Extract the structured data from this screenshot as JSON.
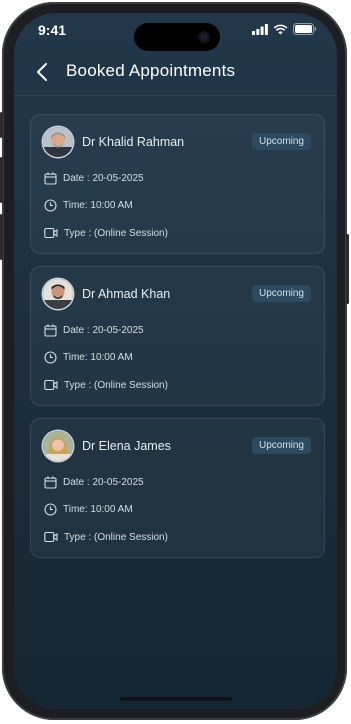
{
  "status_bar": {
    "time": "9:41",
    "icons": [
      "signal-icon",
      "wifi-icon",
      "battery-icon"
    ]
  },
  "header": {
    "back_icon": "chevron-left-icon",
    "title": "Booked Appointments"
  },
  "appointments": [
    {
      "doctor": "Dr Khalid Rahman",
      "status": "Upcoming",
      "date": "Date : 20-05-2025",
      "time": "Time: 10:00 AM",
      "type": "Type : (Online Session)"
    },
    {
      "doctor": "Dr Ahmad Khan",
      "status": "Upcoming",
      "date": "Date : 20-05-2025",
      "time": "Time: 10:00 AM",
      "type": "Type : (Online Session)"
    },
    {
      "doctor": "Dr Elena James",
      "status": "Upcoming",
      "date": "Date : 20-05-2025",
      "time": "Time: 10:00 AM",
      "type": "Type : (Online Session)"
    }
  ],
  "colors": {
    "background": "#1b2f3f",
    "badge_bg": "#2e4a60",
    "text": "#e9eef2"
  }
}
